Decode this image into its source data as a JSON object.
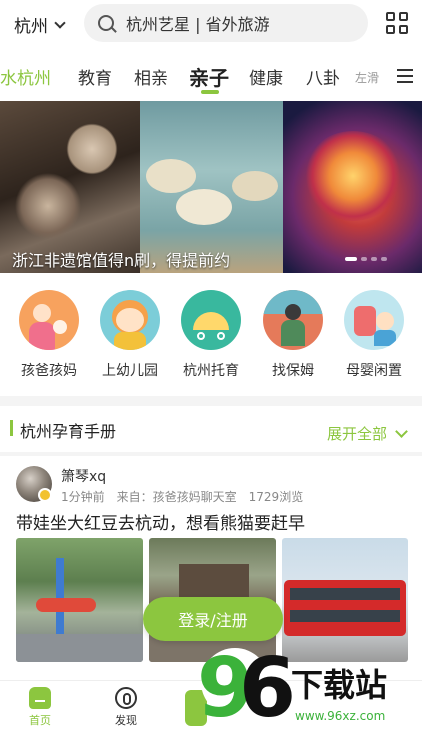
{
  "header": {
    "city": "杭州",
    "search_placeholder": "杭州艺星 | 省外旅游",
    "icons": {
      "city": "chevron-down-icon",
      "search": "search-icon",
      "grid": "grid-icon"
    }
  },
  "tabs": {
    "items": [
      "水杭州",
      "教育",
      "相亲",
      "亲子",
      "健康",
      "八卦"
    ],
    "active": "亲子",
    "hint": "左滑",
    "menu_icon": "menu-icon"
  },
  "banner": {
    "caption": "浙江非遗馆值得n刷，得提前约",
    "slides": 4,
    "active_slide": 1
  },
  "categories": [
    {
      "label": "孩爸孩妈",
      "icon": "parents-icon"
    },
    {
      "label": "上幼儿园",
      "icon": "kindergarten-icon"
    },
    {
      "label": "杭州托育",
      "icon": "childcare-icon"
    },
    {
      "label": "找保姆",
      "icon": "nanny-icon"
    },
    {
      "label": "母婴闲置",
      "icon": "baby-goods-icon"
    }
  ],
  "handbook": {
    "title": "杭州孕育手册",
    "expand_label": "展开全部"
  },
  "post": {
    "user": "箫琴xq",
    "time": "1分钟前",
    "source": "来自：孩爸孩妈聊天室",
    "views": "1729浏览",
    "title": "带娃坐大红豆去杭动，想看熊猫要赶早"
  },
  "login_button": "登录/注册",
  "bottom_nav": {
    "home": "首页",
    "discover": "发现"
  },
  "watermark": {
    "brand": "96下载站",
    "url": "www.96xz.com"
  },
  "colors": {
    "accent": "#8cc63f",
    "text": "#222222",
    "meta": "#888888"
  }
}
